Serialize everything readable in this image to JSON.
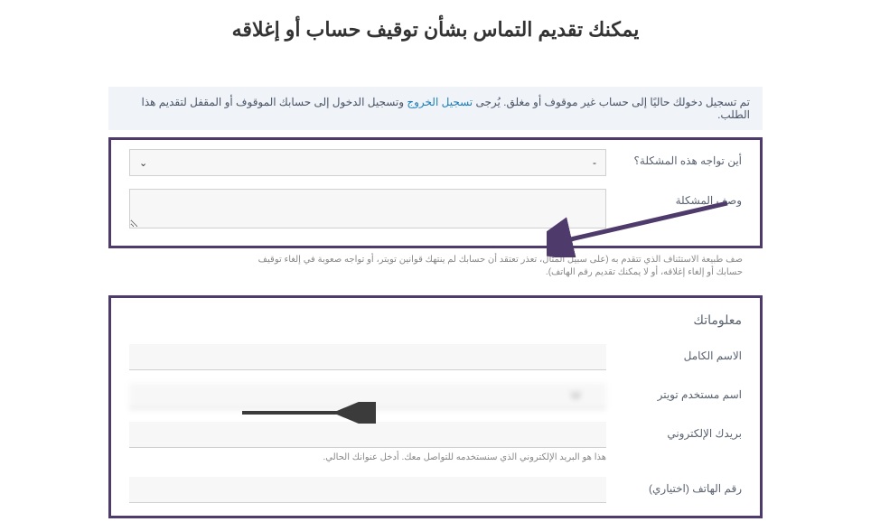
{
  "title": "يمكنك تقديم التماس بشأن توقيف حساب أو إغلاقه",
  "alert": {
    "prefix": "تم تسجيل دخولك حاليًا إلى حساب غير موقوف أو مغلق. يُرجى ",
    "link1": "تسجيل الخروج",
    "mid": " وتسجيل الدخول إلى حسابك الموقوف أو المقفل لتقديم هذا الطلب.",
    "link2": ""
  },
  "where": {
    "label": "أين تواجه هذه المشكلة؟",
    "value": "-"
  },
  "description": {
    "label": "وصف المشكلة",
    "hint": "صف طبيعة الاستئناف الذي تتقدم به (على سبيل المثال، تعذر تعتقد أن حسابك لم ينتهك قوانين تويتر، أو تواجه صعوبة في إلغاء توقيف حسابك أو إلغاء إغلاقه، أو لا يمكنك تقديم رقم الهاتف)."
  },
  "info": {
    "title": "معلوماتك",
    "fullname": {
      "label": "الاسم الكامل",
      "value": ""
    },
    "username": {
      "label": "اسم مستخدم تويتر",
      "value": "W"
    },
    "email": {
      "label": "بريدك الإلكتروني",
      "value": "",
      "hint": "هذا هو البريد الإلكتروني الذي سنستخدمه للتواصل معك. أدخل عنوانك الحالي."
    },
    "phone": {
      "label": "رقم الهاتف (اختياري)",
      "value": ""
    }
  }
}
